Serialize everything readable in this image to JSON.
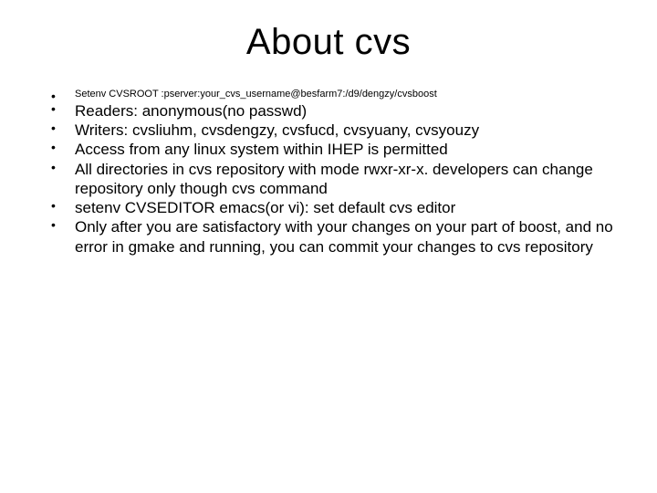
{
  "title": "About cvs",
  "bullets": {
    "setenv_root": "Setenv CVSROOT :pserver:your_cvs_username@besfarm7:/d9/dengzy/cvsboost",
    "readers": "Readers: anonymous(no passwd)",
    "writers": "Writers: cvsliuhm, cvsdengzy, cvsfucd, cvsyuany, cvsyouzy",
    "access": "Access from any linux system within IHEP is permitted",
    "dirs": "All directories in cvs repository with mode rwxr-xr-x. developers can change repository only though cvs command",
    "editor": "setenv CVSEDITOR emacs(or vi):  set default cvs editor",
    "commit": "Only after you are satisfactory with your changes on your part of boost, and no error in gmake and running, you can commit your changes to cvs repository"
  }
}
